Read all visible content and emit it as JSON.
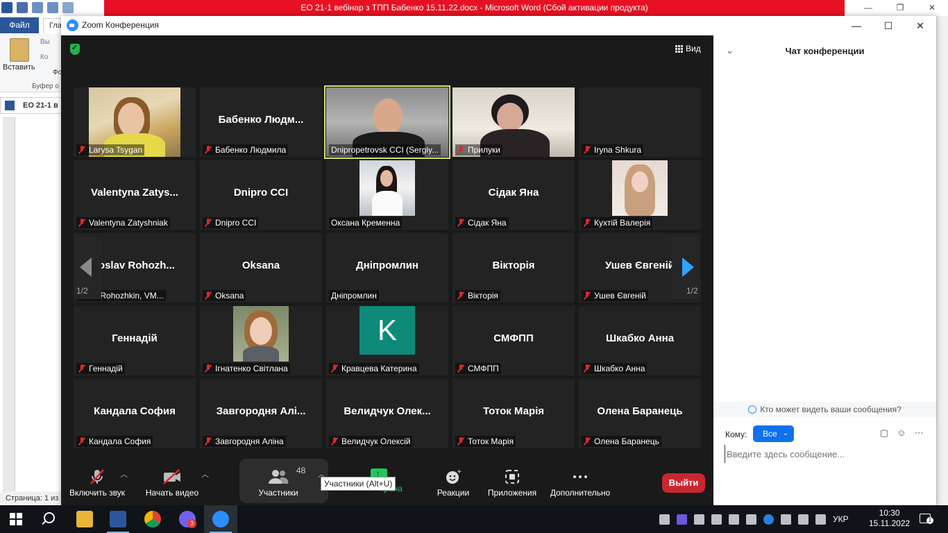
{
  "word": {
    "title": "ЕО 21-1 вебінар з ТПП Бабенко 15.11.22.docx  -  Microsoft Word (Сбой активации продукта)",
    "file_tab": "Файл",
    "tab2": "Гла",
    "paste_label": "Вставить",
    "mini1": "Вы",
    "mini2": "Ко",
    "mini3": "Фо",
    "group_label": "Буфер о",
    "doc_tab": "ЕО 21-1 в",
    "status": "Страница: 1 из",
    "min": "—",
    "max": "❐",
    "close": "✕"
  },
  "zoom": {
    "title": "Zoom Конференция",
    "min": "—",
    "max": "☐",
    "close": "✕",
    "view_label": "Вид",
    "page_left": "1/2",
    "page_right": "1/2",
    "tiles": [
      {
        "name": "Larysa Tsygan",
        "big": "",
        "muted": true
      },
      {
        "name": "Бабенко Людмила",
        "big": "Бабенко  Людм...",
        "muted": true
      },
      {
        "name": "Dnipropetrovsk CCI (Sergiy...",
        "big": "",
        "muted": false
      },
      {
        "name": "Прилуки",
        "big": "",
        "muted": true
      },
      {
        "name": "Iryna Shkura",
        "big": "",
        "muted": true
      },
      {
        "name": "Valentyna Zatyshniak",
        "big": "Valentyna  Zatys...",
        "muted": true
      },
      {
        "name": "Dnipro CCI",
        "big": "Dnipro CCI",
        "muted": true
      },
      {
        "name": "Оксана Кременна",
        "big": "",
        "muted": false
      },
      {
        "name": "Сідак Яна",
        "big": "Сідак Яна",
        "muted": true
      },
      {
        "name": "Кухтій Валерія",
        "big": "",
        "muted": true
      },
      {
        "name": "oslav Rohozhkin, VM...",
        "big": "roslav  Rohozh...",
        "muted": false
      },
      {
        "name": "Oksana",
        "big": "Oksana",
        "muted": true
      },
      {
        "name": "Дніпромлин",
        "big": "Дніпромлин",
        "muted": false
      },
      {
        "name": "Вікторія",
        "big": "Вікторія",
        "muted": true
      },
      {
        "name": "Ушев Євгеній",
        "big": "Ушев Євгеній",
        "muted": true
      },
      {
        "name": "Геннадій",
        "big": "Геннадій",
        "muted": true
      },
      {
        "name": "Ігнатенко Світлана",
        "big": "",
        "muted": true
      },
      {
        "name": "Кравцева Катерина",
        "big": "",
        "muted": true
      },
      {
        "name": "СМФПП",
        "big": "СМФПП",
        "muted": true
      },
      {
        "name": "Шкабко Анна",
        "big": "Шкабко Анна",
        "muted": true
      },
      {
        "name": "Кандала София",
        "big": "Кандала София",
        "muted": true
      },
      {
        "name": "Завгородня Аліна",
        "big": "Завгородня  Алі...",
        "muted": true
      },
      {
        "name": "Велидчук Олексій",
        "big": "Велидчук  Олек...",
        "muted": true
      },
      {
        "name": "Тоток Марія",
        "big": "Тоток Марія",
        "muted": true
      },
      {
        "name": "Олена Баранець",
        "big": "Олена Баранець",
        "muted": true
      }
    ],
    "avatar_letter": "K",
    "toolbar": {
      "unmute": "Включить звук",
      "start_video": "Начать видео",
      "participants": "Участники",
      "participants_count": "48",
      "share": "крана",
      "reactions": "Реакции",
      "apps": "Приложения",
      "more": "Дополнительно",
      "leave": "Выйти",
      "tooltip": "Участники (Alt+U)"
    },
    "chat": {
      "title": "Чат конференции",
      "hint": "Кто может видеть ваши сообщения?",
      "to_label": "Кому:",
      "recipient": "Все",
      "placeholder": "Введите здесь сообщение..."
    }
  },
  "taskbar": {
    "lang": "УКР",
    "time": "10:30",
    "date": "15.11.2022",
    "viber_badge": "3",
    "notif_count": "1"
  },
  "colors": {
    "zoom_blue": "#0e72ed",
    "leave_red": "#c9262f",
    "word_red": "#e81123",
    "meeting_bg": "#1a1a1a"
  }
}
